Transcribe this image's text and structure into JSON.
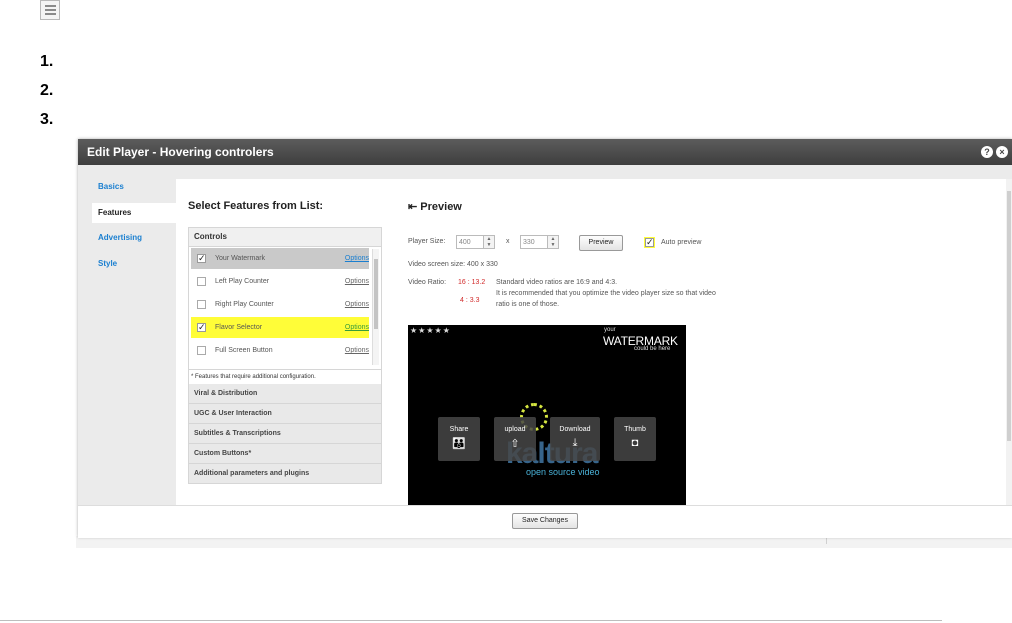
{
  "steps": [
    "1.",
    "2.",
    "3."
  ],
  "dialog": {
    "title": "Edit Player - Hovering controlers",
    "help_icon": "?",
    "close_icon": "×"
  },
  "sidebar": {
    "items": [
      {
        "label": "Basics",
        "active": false
      },
      {
        "label": "Features",
        "active": true
      },
      {
        "label": "Advertising",
        "active": false
      },
      {
        "label": "Style",
        "active": false
      }
    ]
  },
  "features": {
    "heading": "Select Features from List:",
    "controls_header": "Controls",
    "rows": [
      {
        "label": "Your Watermark",
        "checked": true,
        "options": "Options"
      },
      {
        "label": "Left Play Counter",
        "checked": false,
        "options": "Options"
      },
      {
        "label": "Right Play Counter",
        "checked": false,
        "options": "Options"
      },
      {
        "label": "Flavor Selector",
        "checked": true,
        "options": "Options"
      },
      {
        "label": "Full Screen Button",
        "checked": false,
        "options": "Options"
      }
    ],
    "footnote": "* Features that require additional configuration.",
    "sections": [
      "Viral & Distribution",
      "UGC & User Interaction",
      "Subtitles & Transcriptions",
      "Custom Buttons*",
      "Additional parameters and plugins"
    ]
  },
  "preview": {
    "heading": "Preview",
    "player_size_label": "Player Size:",
    "width_value": "400",
    "times": "x",
    "height_value": "330",
    "preview_button": "Preview",
    "auto_preview_label": "Auto preview",
    "screen_size": "Video screen size: 400 x 330",
    "ratio_label": "Video Ratio:",
    "ratio_a": "16 : 13.2",
    "ratio_b": "4 : 3.3",
    "ratio_note1": "Standard video ratios are 16:9 and 4:3.",
    "ratio_note2": "It is recommended that you optimize the video player size so that video",
    "ratio_note3": "ratio is one of those."
  },
  "video": {
    "stars": "★★★★★",
    "wm_small": "your",
    "wm_big": "WATERMARK",
    "wm_sub": "could be here",
    "logo": "kaltura",
    "logo_sub": "open source video",
    "tiles": [
      {
        "label": "Share",
        "icon": "share-icon",
        "glyph": "👪"
      },
      {
        "label": "upload",
        "icon": "upload-icon",
        "glyph": "⇧"
      },
      {
        "label": "Download",
        "icon": "download-icon",
        "glyph": "⤓"
      },
      {
        "label": "Thumb",
        "icon": "camera-icon",
        "glyph": "◘"
      }
    ]
  },
  "footer": {
    "save_button": "Save Changes"
  },
  "colors": {
    "highlight": "#fffd38",
    "link": "#1a7fd0",
    "ratio_red": "#d12a2a"
  }
}
